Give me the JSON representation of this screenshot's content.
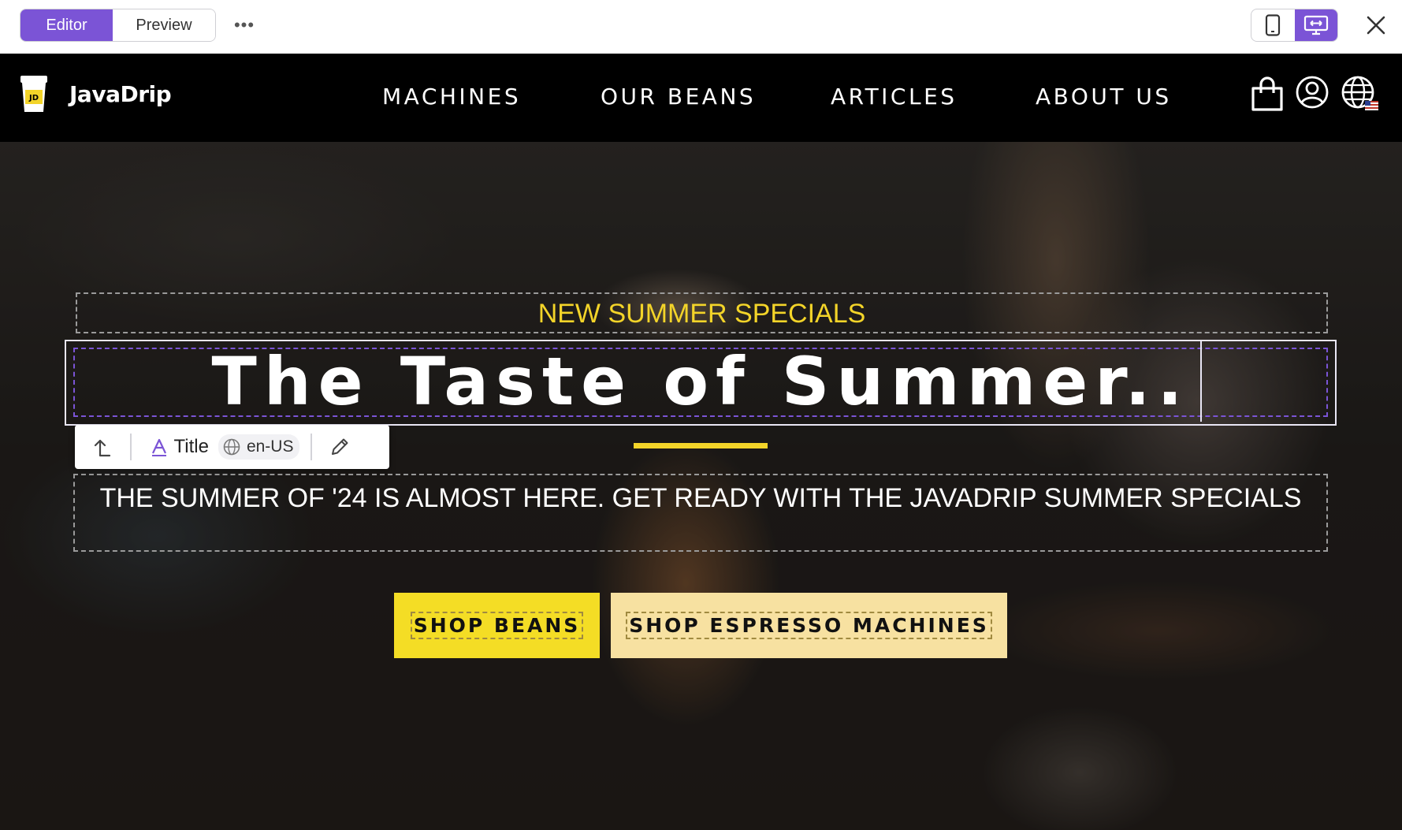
{
  "editor": {
    "modes": {
      "editor": "Editor",
      "preview": "Preview"
    },
    "more_label": "•••",
    "accent_color": "#7b54d6"
  },
  "site": {
    "brand": "JavaDrip",
    "logo_badge": "JD",
    "nav": [
      "MACHINES",
      "OUR BEANS",
      "ARTICLES",
      "ABOUT US"
    ],
    "header_icons": [
      "shopping-bag-icon",
      "account-icon",
      "globe-language-icon"
    ]
  },
  "toolbar": {
    "element_type": "Title",
    "locale": "en-US",
    "icons": [
      "select-parent-icon",
      "text-style-icon",
      "globe-icon",
      "edit-pencil-icon"
    ]
  },
  "hero": {
    "eyebrow": "NEW SUMMER SPECIALS",
    "title": "The Taste of Summer..",
    "subtitle": "THE SUMMER OF '24 IS ALMOST HERE. GET READY WITH THE JAVADRIP SUMMER SPECIALS",
    "cta_primary": "SHOP BEANS",
    "cta_secondary": "SHOP ESPRESSO MACHINES",
    "accent_yellow": "#f3d429"
  }
}
